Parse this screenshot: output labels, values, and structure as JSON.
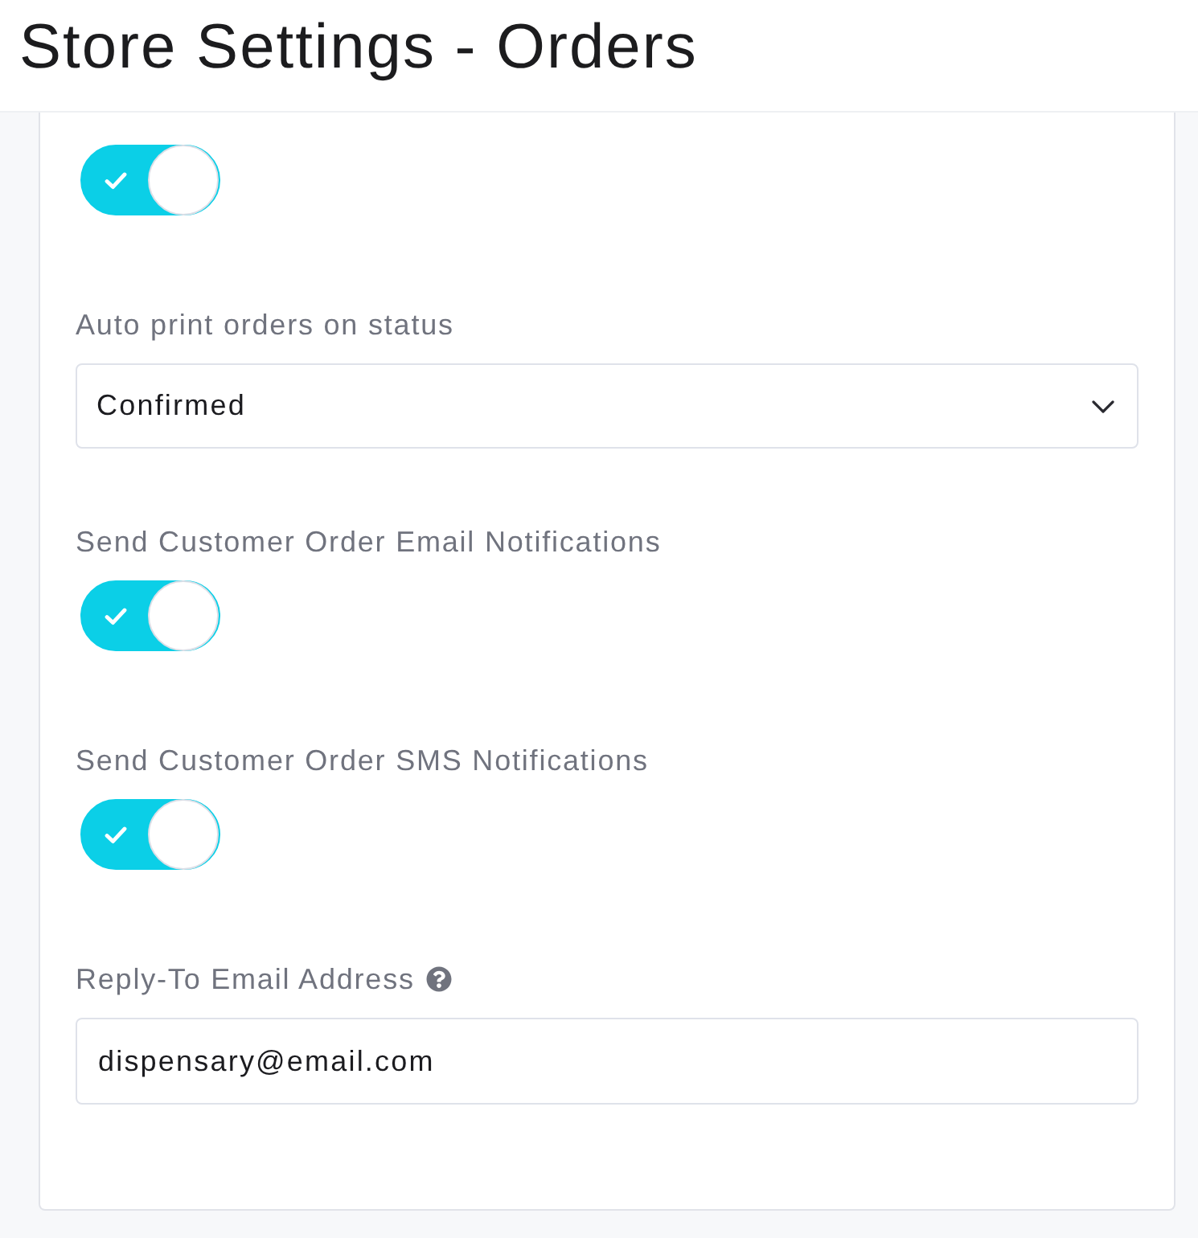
{
  "page": {
    "title": "Store Settings - Orders"
  },
  "settings": [
    {
      "kind": "toggle",
      "on": true
    },
    {
      "kind": "select",
      "label": "Auto print orders on status",
      "value": "Confirmed"
    },
    {
      "kind": "toggle",
      "label": "Send Customer Order Email Notifications",
      "on": true
    },
    {
      "kind": "toggle",
      "label": "Send Customer Order SMS Notifications",
      "on": true
    },
    {
      "kind": "text",
      "label": "Reply-To Email Address",
      "help": true,
      "value": "dispensary@email.com"
    }
  ]
}
